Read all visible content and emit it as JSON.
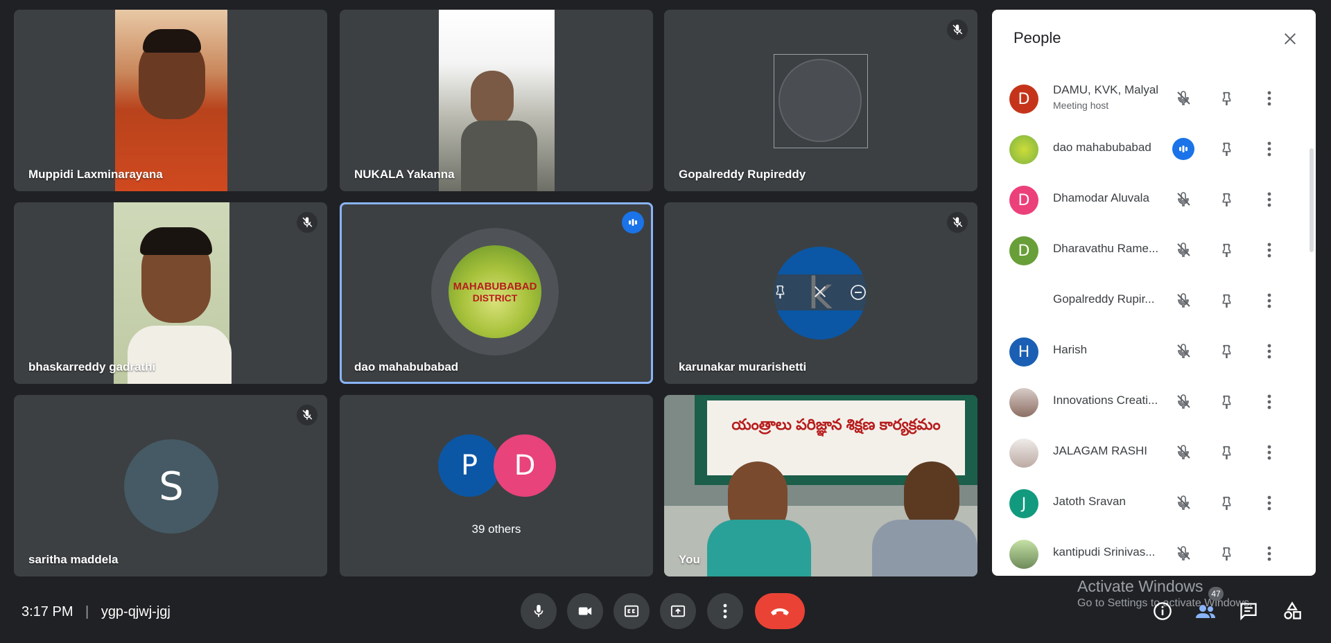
{
  "tiles": [
    {
      "name": "Muppidi Laxminarayana",
      "muted": false,
      "video": true
    },
    {
      "name": "NUKALA Yakanna",
      "muted": false,
      "video": true
    },
    {
      "name": "Gopalreddy Rupireddy",
      "muted": true,
      "video": false
    },
    {
      "name": "bhaskarreddy gadrathi",
      "muted": true,
      "video": true
    },
    {
      "name": "dao mahabubabad",
      "muted": false,
      "speaking": true,
      "avatar_text_1": "MAHABUBABAD",
      "avatar_text_2": "DISTRICT"
    },
    {
      "name": "karunakar murarishetti",
      "muted": true,
      "avatar_letter": "k"
    },
    {
      "name": "saritha maddela",
      "muted": true,
      "avatar_letter": "S"
    },
    {
      "name": "39 others",
      "letters": [
        "P",
        "D"
      ]
    },
    {
      "name": "You",
      "video": true,
      "banner_text": "యంత్రాలు పరిజ్ఞాన శిక్షణ కార్యక్రమం"
    }
  ],
  "colors": {
    "background": "#202124",
    "tile": "#3c4043",
    "speaking_border": "#8ab4f8",
    "accent": "#1a73e8",
    "hangup": "#ea4335"
  },
  "panel": {
    "title": "People",
    "participants": [
      {
        "name": "DAMU, KVK, Malyal",
        "sub": "Meeting host",
        "letter": "D",
        "color": "#c5341a",
        "mic": "muted"
      },
      {
        "name": "dao mahabubabad",
        "letter": "",
        "color": "#7cb342",
        "mic": "speaking"
      },
      {
        "name": "Dhamodar Aluvala",
        "letter": "D",
        "color": "#ec407a",
        "mic": "muted"
      },
      {
        "name": "Dharavathu Rame...",
        "letter": "D",
        "color": "#689f38",
        "mic": "muted"
      },
      {
        "name": "Gopalreddy Rupir...",
        "letter": "",
        "color": "#ffffff",
        "mic": "muted"
      },
      {
        "name": "Harish",
        "letter": "H",
        "color": "#1a5fb4",
        "mic": "muted"
      },
      {
        "name": "Innovations Creati...",
        "letter": "",
        "color": "#8d6e63",
        "mic": "muted"
      },
      {
        "name": "JALAGAM RASHI",
        "letter": "",
        "color": "#bcaaa4",
        "mic": "muted"
      },
      {
        "name": "Jatoth Sravan",
        "letter": "J",
        "color": "#129a7e",
        "mic": "muted"
      },
      {
        "name": "kantipudi Srinivas...",
        "letter": "",
        "color": "#6d8a5a",
        "mic": "muted"
      }
    ]
  },
  "bottom": {
    "time": "3:17 PM",
    "separator": "|",
    "meeting_code": "ygp-qjwj-jgj",
    "participant_count": "47",
    "controls": [
      "mic-icon",
      "camera-icon",
      "captions-icon",
      "present-icon",
      "more-icon",
      "hangup-icon"
    ],
    "right_controls": [
      "info-icon",
      "people-icon",
      "chat-icon",
      "activities-icon"
    ]
  },
  "watermark": {
    "line1": "Activate Windows",
    "line2": "Go to Settings to activate Windows."
  }
}
